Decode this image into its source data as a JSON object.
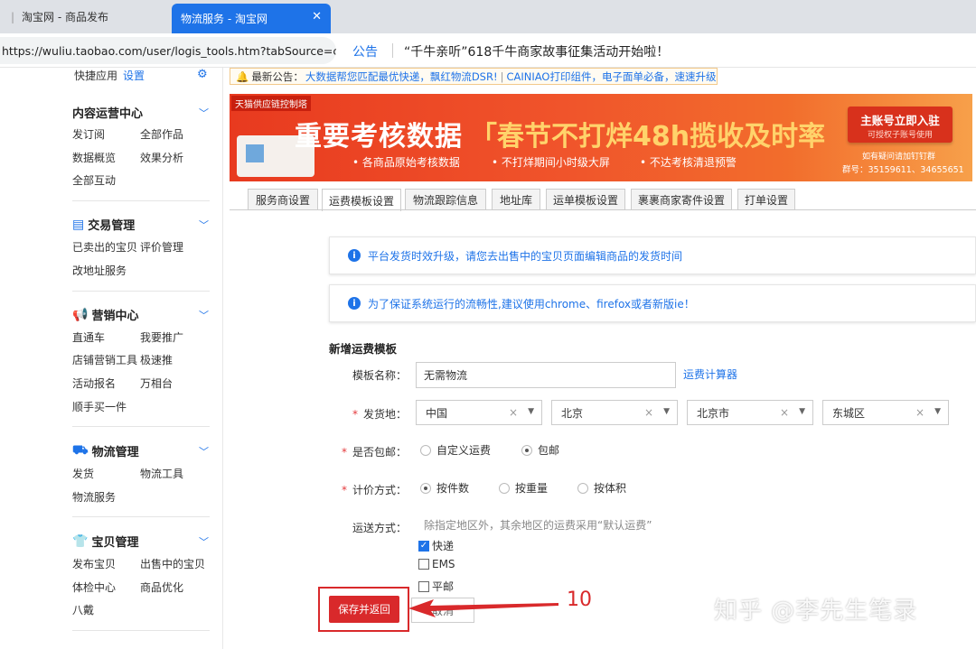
{
  "browser": {
    "tab1_title": "淘宝网 - 商品发布",
    "tab2_title": "物流服务 - 淘宝网",
    "url": "https://wuliu.taobao.com/user/logis_tools.htm?tabSource=carr"
  },
  "notice": {
    "label": "公告",
    "text": "“千牛亲听”618千牛商家故事征集活动开始啦！"
  },
  "sidebar": {
    "top_label": "快捷应用",
    "top_link": "设置",
    "sections": [
      {
        "title": "内容运营中心",
        "items": [
          "发订阅",
          "全部作品",
          "数据概览",
          "效果分析",
          "全部互动"
        ]
      },
      {
        "title": "交易管理",
        "items": [
          "已卖出的宝贝",
          "评价管理",
          "改地址服务"
        ]
      },
      {
        "title": "营销中心",
        "items": [
          "直通车",
          "我要推广",
          "店铺营销工具",
          "极速推",
          "活动报名",
          "万相台",
          "顺手买一件"
        ]
      },
      {
        "title": "物流管理",
        "items": [
          "发货",
          "物流工具",
          "物流服务"
        ]
      },
      {
        "title": "宝贝管理",
        "items": [
          "发布宝贝",
          "出售中的宝贝",
          "体检中心",
          "商品优化",
          "八戴"
        ]
      }
    ]
  },
  "announce": {
    "label": "最新公告：",
    "link1": "大数据帮您匹配最优快递，飘红物流DSR!",
    "link2": "CAINIAO打印组件，电子面单必备，速速升级"
  },
  "banner": {
    "tag": "天猫供应链控制塔",
    "headline": "重要考核数据",
    "headline2": "「春节不打烊48h揽收及时率",
    "sub1": "• 各商品原始考核数据",
    "sub2": "• 不打烊期间小时级大屏",
    "sub3": "• 不达考核清退预警",
    "cta_title": "主账号立即入驻",
    "cta_sub": "可授权子账号使用",
    "group_line1": "如有疑问请加钉钉群",
    "group_line2": "群号：35159611、34655651"
  },
  "tabs": [
    "服务商设置",
    "运费模板设置",
    "物流跟踪信息",
    "地址库",
    "运单模板设置",
    "裹裹商家寄件设置",
    "打单设置"
  ],
  "info1": "平台发货时效升级，请您去出售中的宝贝页面编辑商品的发货时间",
  "info2": "为了保证系统运行的流畅性,建议使用chrome、firefox或者新版ie！",
  "form": {
    "title": "新增运费模板",
    "name_label": "模板名称：",
    "name_value": "无需物流",
    "calc_link": "运费计算器",
    "origin_label": "发货地：",
    "origin": [
      "中国",
      "北京",
      "北京市",
      "东城区"
    ],
    "free_label": "是否包邮：",
    "free_options": [
      "自定义运费",
      "包邮"
    ],
    "pricing_label": "计价方式：",
    "pricing_options": [
      "按件数",
      "按重量",
      "按体积"
    ],
    "ship_label": "运送方式：",
    "ship_hint": "除指定地区外，其余地区的运费采用“默认运费”",
    "ship_options": [
      "快递",
      "EMS",
      "平邮"
    ],
    "save_button": "保存并返回",
    "cancel_button": "取消"
  },
  "annotation_number": "10",
  "watermark": "知乎 @李先生笔录",
  "colors": {
    "accent": "#1e73e8",
    "red": "#d9292b"
  }
}
